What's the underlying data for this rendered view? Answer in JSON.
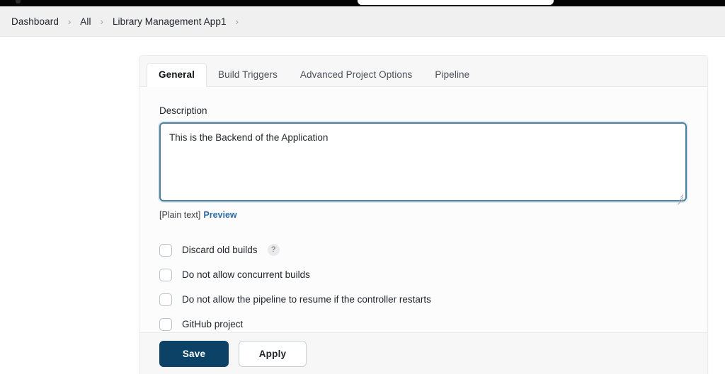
{
  "window": {
    "top_strip": {
      "pill_label": "",
      "dot_label": ""
    }
  },
  "breadcrumb": {
    "items": [
      {
        "label": "Dashboard"
      },
      {
        "label": "All"
      },
      {
        "label": "Library Management App1"
      }
    ],
    "separator": "›"
  },
  "tabs": [
    {
      "label": "General",
      "active": true
    },
    {
      "label": "Build Triggers",
      "active": false
    },
    {
      "label": "Advanced Project Options",
      "active": false
    },
    {
      "label": "Pipeline",
      "active": false
    }
  ],
  "form": {
    "description": {
      "label": "Description",
      "value": "This is the Backend of the Application",
      "placeholder": "",
      "plain_text_note": "[Plain text]",
      "preview_link": "Preview"
    },
    "checkboxes": [
      {
        "label": "Discard old builds",
        "checked": false,
        "help": "?"
      },
      {
        "label": "Do not allow concurrent builds",
        "checked": false
      },
      {
        "label": "Do not allow the pipeline to resume if the controller restarts",
        "checked": false
      },
      {
        "label": "GitHub project",
        "checked": false
      }
    ]
  },
  "footer": {
    "save_label": "Save",
    "apply_label": "Apply"
  },
  "colors": {
    "primary_button": "#0b4266",
    "link": "#2d6aa8",
    "focus_border": "#4b7f9e",
    "breadcrumb_bg": "#f0f0f0",
    "tabbar_bg": "#f7f7f7"
  }
}
